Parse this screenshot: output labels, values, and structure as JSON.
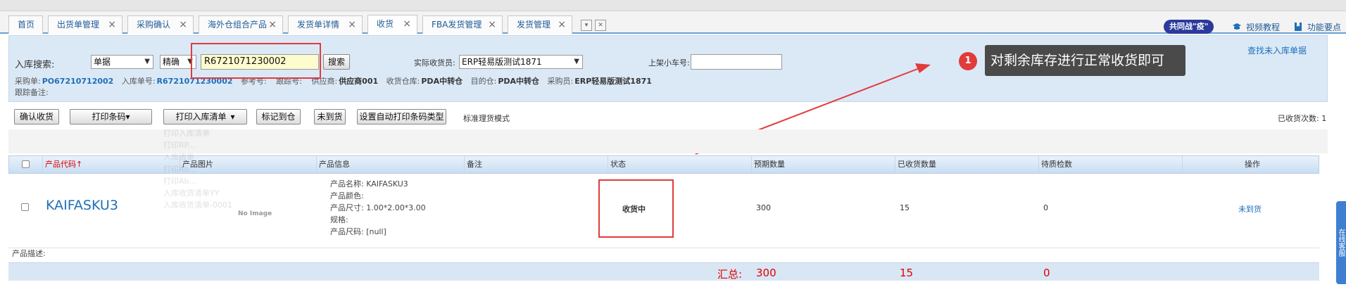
{
  "tabs": [
    {
      "label": "首页",
      "closable": false,
      "active": false
    },
    {
      "label": "出货单管理",
      "closable": true,
      "active": false
    },
    {
      "label": "采购确认",
      "closable": true,
      "active": false
    },
    {
      "label": "海外仓组合产品",
      "closable": true,
      "active": false
    },
    {
      "label": "发货单详情",
      "closable": true,
      "active": false
    },
    {
      "label": "收货",
      "closable": true,
      "active": true
    },
    {
      "label": "FBA发货管理",
      "closable": true,
      "active": false
    },
    {
      "label": "发货管理",
      "closable": true,
      "active": false
    }
  ],
  "tab_close_glyph": "×",
  "top_right": {
    "campaign_badge": "共同战\"疫\"",
    "video_tutorial": "视频教程",
    "feature_points": "功能要点"
  },
  "search": {
    "label": "入库搜索:",
    "type_select": "单据",
    "match_select": "精确",
    "keyword": "R6721071230002",
    "search_button": "搜索",
    "receiver_label": "实际收货员:",
    "receiver_value": "ERP轻易版测试1871",
    "cart_label": "上架小车号:",
    "cart_value": "",
    "find_link": "查找未入库单据"
  },
  "meta": {
    "po_label": "采购单:",
    "po_value": "PO67210712002",
    "inbound_label": "入库单号:",
    "inbound_value": "R6721071230002",
    "ref_label": "参考号:",
    "track_label": "跟踪号:",
    "supplier_label": "供应商:",
    "supplier_value": "供应商001",
    "warehouse_label": "收货仓库:",
    "warehouse_value": "PDA中转仓",
    "dest_label": "目的仓:",
    "dest_value": "PDA中转仓",
    "buyer_label": "采购员:",
    "buyer_value": "ERP轻易版测试1871",
    "remark_label": "跟踪备注:"
  },
  "annotation": {
    "number": "1",
    "text": "对剩余库存进行正常收货即可"
  },
  "toolbar": {
    "confirm": "确认收货",
    "print_barcode": "打印条码",
    "print_inbound": "打印入库清单",
    "mark_arrived": "标记到仓",
    "not_arrived": "未到货",
    "auto_print_type": "设置自动打印条码类型",
    "mode": "标准理货模式",
    "received_count": "已收货次数: 1"
  },
  "table": {
    "headers": [
      "产品代码",
      "产品图片",
      "产品信息",
      "备注",
      "状态",
      "预期数量",
      "已收货数量",
      "待质检数",
      "操作"
    ],
    "row": {
      "sku": "KAIFASKU3",
      "no_image": "No Image",
      "info": [
        "产品名称: KAIFASKU3",
        "产品颜色:",
        "产品尺寸: 1.00*2.00*3.00",
        "规格:",
        "产品尺码: [null]"
      ],
      "remark": "",
      "status": "收货中",
      "expected": "300",
      "received": "15",
      "pending_qc": "0",
      "action": "未到货"
    },
    "desc_label": "产品描述:",
    "summary": {
      "label": "汇总:",
      "expected": "300",
      "received": "15",
      "pending_qc": "0"
    }
  },
  "ghost_menu": [
    "打印入库清单",
    "打印RP...",
    "入库清单",
    "打印Ab...",
    "打印Ab...",
    "入库收货清单YY",
    "入库收货清单-0001"
  ],
  "side_tab": "在线客服",
  "colors": {
    "accent": "#1e6fb8",
    "panel": "#dbe9f7",
    "highlight_red": "#e23b3b",
    "summary_red": "#e00000"
  }
}
